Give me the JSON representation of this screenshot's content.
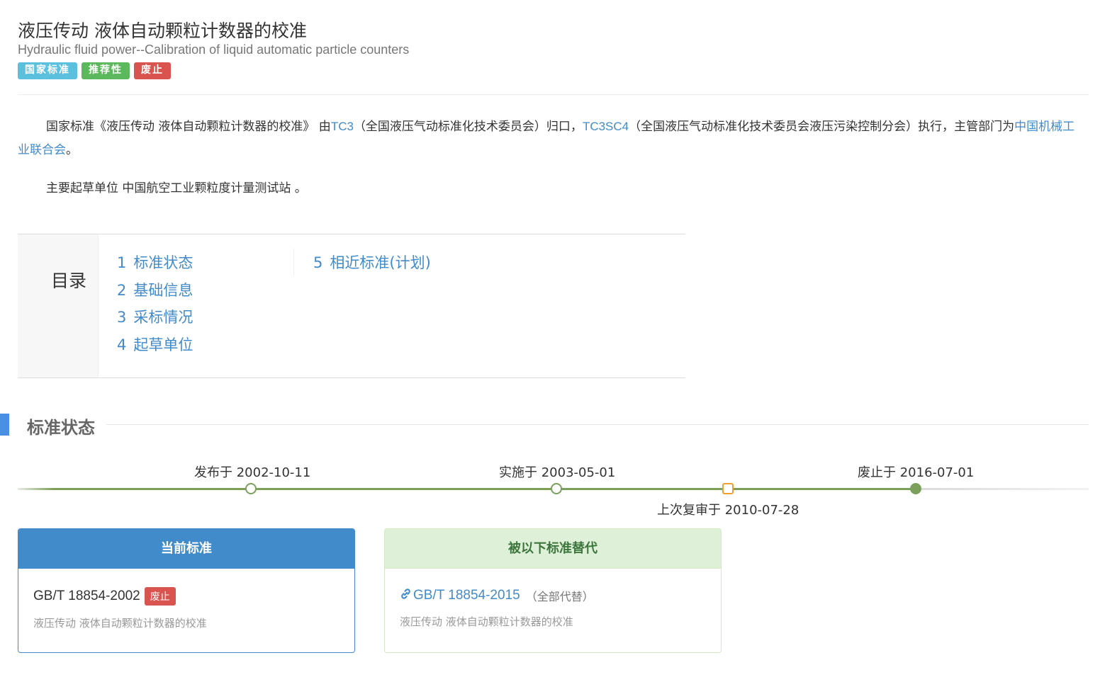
{
  "header": {
    "title_cn": "液压传动 液体自动颗粒计数器的校准",
    "title_en": "Hydraulic fluid power--Calibration of liquid automatic particle counters",
    "badges": [
      "国家标准",
      "推荐性",
      "废止"
    ]
  },
  "intro": {
    "p1_before": "国家标准《液压传动 液体自动颗粒计数器的校准》 由",
    "tc_link": "TC3",
    "tc_desc": "（全国液压气动标准化技术委员会）归口，",
    "sc_link": "TC3SC4",
    "sc_desc": "（全国液压气动标准化技术委员会液压污染控制分会）执行，主管部门为",
    "dept_link": "中国机械工业联合会",
    "p1_end": "。",
    "p2": "主要起草单位 中国航空工业颗粒度计量测试站 。"
  },
  "toc": {
    "label": "目录",
    "items": [
      {
        "num": "1",
        "label": "标准状态"
      },
      {
        "num": "2",
        "label": "基础信息"
      },
      {
        "num": "3",
        "label": "采标情况"
      },
      {
        "num": "4",
        "label": "起草单位"
      },
      {
        "num": "5",
        "label": "相近标准(计划)"
      }
    ]
  },
  "status": {
    "section_title": "标准状态",
    "timeline": {
      "published": "发布于 2002-10-11",
      "implemented": "实施于 2003-05-01",
      "reviewed": "上次复审于 2010-07-28",
      "abolished": "废止于 2016-07-01"
    },
    "current": {
      "header": "当前标准",
      "code": "GB/T 18854-2002",
      "tag": "废止",
      "name": "液压传动 液体自动颗粒计数器的校准"
    },
    "replaced": {
      "header": "被以下标准替代",
      "code": "GB/T 18854-2015",
      "note": "（全部代替）",
      "name": "液压传动 液体自动颗粒计数器的校准"
    }
  },
  "colors": {
    "link": "#428bca",
    "badge_info": "#5bc0de",
    "badge_success": "#5cb85c",
    "badge_danger": "#d9534f",
    "timeline_green": "#7ba05b",
    "review_orange": "#f0a030"
  }
}
